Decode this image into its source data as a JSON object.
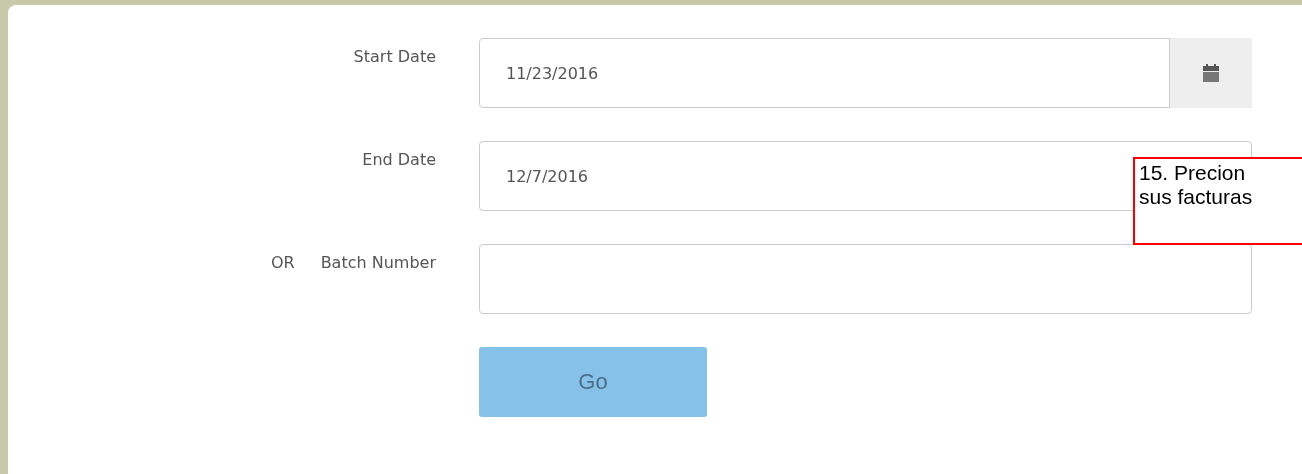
{
  "form": {
    "fields": [
      {
        "label": "Start Date",
        "value": "11/23/2016",
        "calendar_button": true
      },
      {
        "label": "End Date",
        "value": "12/7/2016",
        "calendar_button": false
      },
      {
        "prefix": "OR",
        "label": "Batch Number",
        "calendar_button": false
      }
    ],
    "submit": {
      "label": "Go",
      "disabled": true
    }
  },
  "callout": {
    "lines": [
      "15. Precion",
      "sus facturas"
    ]
  }
}
